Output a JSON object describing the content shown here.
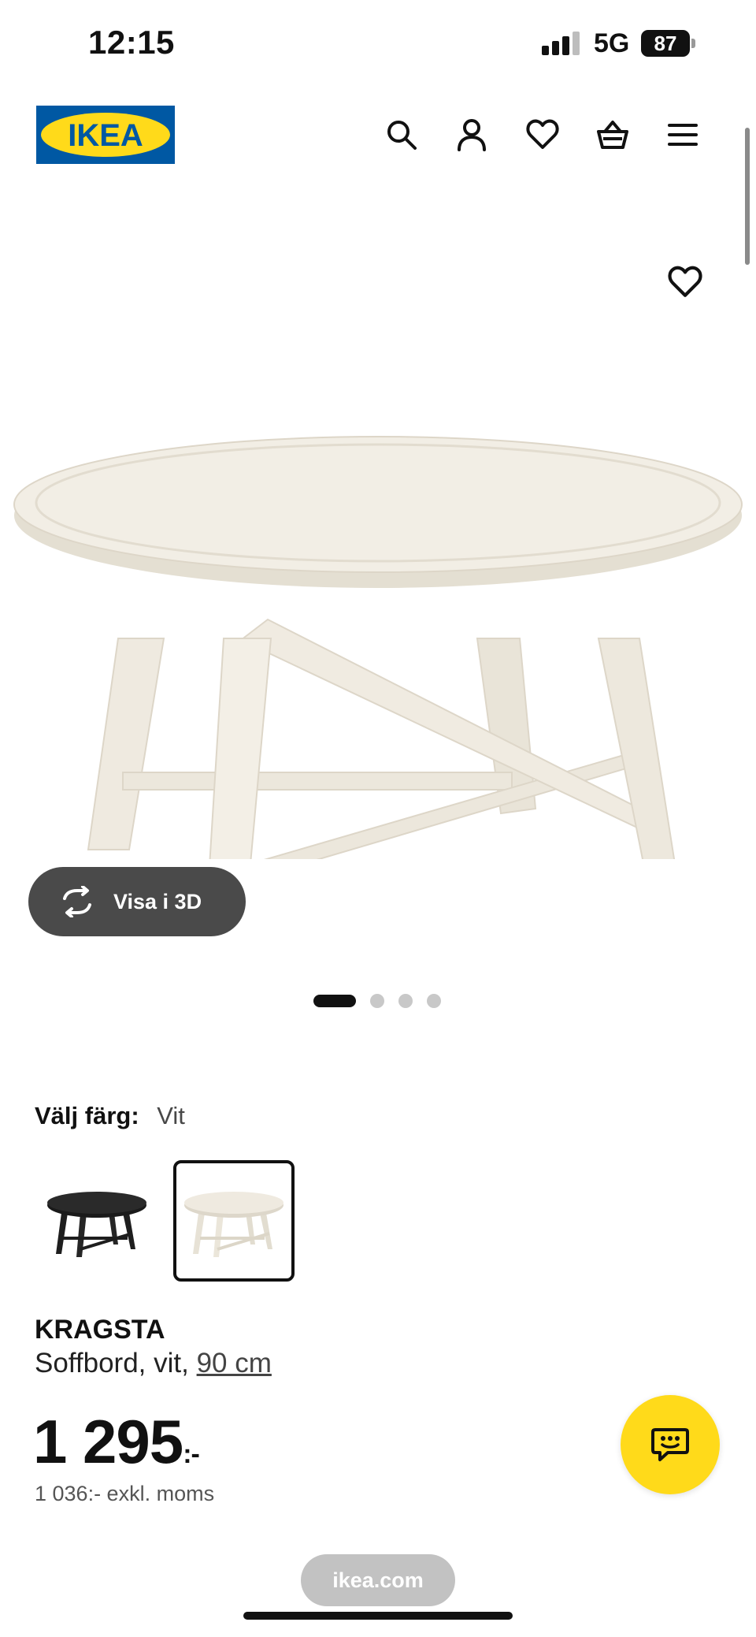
{
  "status_bar": {
    "time": "12:15",
    "network": "5G",
    "battery": "87"
  },
  "header": {
    "logo": "IKEA",
    "icons": [
      "search-icon",
      "account-icon",
      "favorites-icon",
      "cart-icon",
      "menu-icon"
    ]
  },
  "gallery": {
    "view_3d_label": "Visa i 3D",
    "pager": {
      "count": 4,
      "active": 1
    }
  },
  "color_picker": {
    "label": "Välj färg:",
    "selected": "Vit",
    "swatch_colors": {
      "black": "#1e1e1e",
      "white": "#efeae0"
    }
  },
  "product": {
    "name": "KRAGSTA",
    "description": "Soffbord, vit, ",
    "size": "90 cm",
    "price": "1 295",
    "price_suffix": ":-",
    "price_excl_vat": "1 036:- exkl. moms"
  },
  "browser": {
    "url": "ikea.com"
  },
  "colors": {
    "brand_blue": "#0058a3",
    "brand_yellow": "#ffda1a",
    "chat_button": "#ffda1a"
  }
}
